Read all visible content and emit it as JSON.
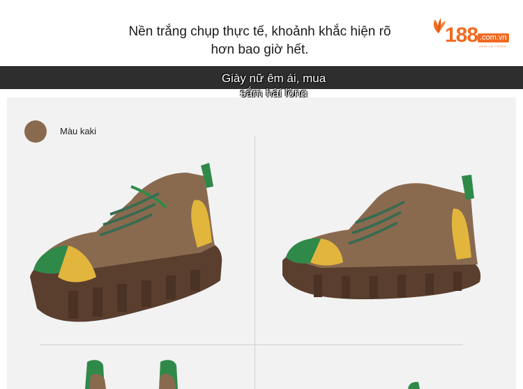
{
  "header": {
    "headline_line1": "Nền trắng chụp thực tế, khoảnh khắc hiện rõ",
    "headline_line2": "hơn bao giờ hết."
  },
  "logo": {
    "number": "188",
    "domain": ".com.vn",
    "tagline": "XEM LÀ THÍCH",
    "brand_color": "#f26a21"
  },
  "banner": {
    "title_line1": "Giày nữ êm ái, mua",
    "title_line2": "sắm hài lòng"
  },
  "product": {
    "color_name": "Màu kaki",
    "swatch_color": "#8a6a4f"
  }
}
